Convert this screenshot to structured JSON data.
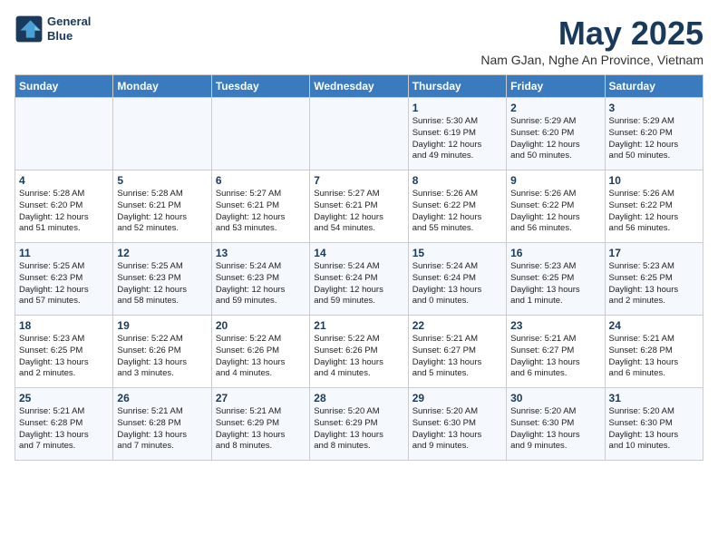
{
  "header": {
    "logo_line1": "General",
    "logo_line2": "Blue",
    "month": "May 2025",
    "location": "Nam GJan, Nghe An Province, Vietnam"
  },
  "weekdays": [
    "Sunday",
    "Monday",
    "Tuesday",
    "Wednesday",
    "Thursday",
    "Friday",
    "Saturday"
  ],
  "weeks": [
    [
      {
        "day": "",
        "info": ""
      },
      {
        "day": "",
        "info": ""
      },
      {
        "day": "",
        "info": ""
      },
      {
        "day": "",
        "info": ""
      },
      {
        "day": "1",
        "info": "Sunrise: 5:30 AM\nSunset: 6:19 PM\nDaylight: 12 hours\nand 49 minutes."
      },
      {
        "day": "2",
        "info": "Sunrise: 5:29 AM\nSunset: 6:20 PM\nDaylight: 12 hours\nand 50 minutes."
      },
      {
        "day": "3",
        "info": "Sunrise: 5:29 AM\nSunset: 6:20 PM\nDaylight: 12 hours\nand 50 minutes."
      }
    ],
    [
      {
        "day": "4",
        "info": "Sunrise: 5:28 AM\nSunset: 6:20 PM\nDaylight: 12 hours\nand 51 minutes."
      },
      {
        "day": "5",
        "info": "Sunrise: 5:28 AM\nSunset: 6:21 PM\nDaylight: 12 hours\nand 52 minutes."
      },
      {
        "day": "6",
        "info": "Sunrise: 5:27 AM\nSunset: 6:21 PM\nDaylight: 12 hours\nand 53 minutes."
      },
      {
        "day": "7",
        "info": "Sunrise: 5:27 AM\nSunset: 6:21 PM\nDaylight: 12 hours\nand 54 minutes."
      },
      {
        "day": "8",
        "info": "Sunrise: 5:26 AM\nSunset: 6:22 PM\nDaylight: 12 hours\nand 55 minutes."
      },
      {
        "day": "9",
        "info": "Sunrise: 5:26 AM\nSunset: 6:22 PM\nDaylight: 12 hours\nand 56 minutes."
      },
      {
        "day": "10",
        "info": "Sunrise: 5:26 AM\nSunset: 6:22 PM\nDaylight: 12 hours\nand 56 minutes."
      }
    ],
    [
      {
        "day": "11",
        "info": "Sunrise: 5:25 AM\nSunset: 6:23 PM\nDaylight: 12 hours\nand 57 minutes."
      },
      {
        "day": "12",
        "info": "Sunrise: 5:25 AM\nSunset: 6:23 PM\nDaylight: 12 hours\nand 58 minutes."
      },
      {
        "day": "13",
        "info": "Sunrise: 5:24 AM\nSunset: 6:23 PM\nDaylight: 12 hours\nand 59 minutes."
      },
      {
        "day": "14",
        "info": "Sunrise: 5:24 AM\nSunset: 6:24 PM\nDaylight: 12 hours\nand 59 minutes."
      },
      {
        "day": "15",
        "info": "Sunrise: 5:24 AM\nSunset: 6:24 PM\nDaylight: 13 hours\nand 0 minutes."
      },
      {
        "day": "16",
        "info": "Sunrise: 5:23 AM\nSunset: 6:25 PM\nDaylight: 13 hours\nand 1 minute."
      },
      {
        "day": "17",
        "info": "Sunrise: 5:23 AM\nSunset: 6:25 PM\nDaylight: 13 hours\nand 2 minutes."
      }
    ],
    [
      {
        "day": "18",
        "info": "Sunrise: 5:23 AM\nSunset: 6:25 PM\nDaylight: 13 hours\nand 2 minutes."
      },
      {
        "day": "19",
        "info": "Sunrise: 5:22 AM\nSunset: 6:26 PM\nDaylight: 13 hours\nand 3 minutes."
      },
      {
        "day": "20",
        "info": "Sunrise: 5:22 AM\nSunset: 6:26 PM\nDaylight: 13 hours\nand 4 minutes."
      },
      {
        "day": "21",
        "info": "Sunrise: 5:22 AM\nSunset: 6:26 PM\nDaylight: 13 hours\nand 4 minutes."
      },
      {
        "day": "22",
        "info": "Sunrise: 5:21 AM\nSunset: 6:27 PM\nDaylight: 13 hours\nand 5 minutes."
      },
      {
        "day": "23",
        "info": "Sunrise: 5:21 AM\nSunset: 6:27 PM\nDaylight: 13 hours\nand 6 minutes."
      },
      {
        "day": "24",
        "info": "Sunrise: 5:21 AM\nSunset: 6:28 PM\nDaylight: 13 hours\nand 6 minutes."
      }
    ],
    [
      {
        "day": "25",
        "info": "Sunrise: 5:21 AM\nSunset: 6:28 PM\nDaylight: 13 hours\nand 7 minutes."
      },
      {
        "day": "26",
        "info": "Sunrise: 5:21 AM\nSunset: 6:28 PM\nDaylight: 13 hours\nand 7 minutes."
      },
      {
        "day": "27",
        "info": "Sunrise: 5:21 AM\nSunset: 6:29 PM\nDaylight: 13 hours\nand 8 minutes."
      },
      {
        "day": "28",
        "info": "Sunrise: 5:20 AM\nSunset: 6:29 PM\nDaylight: 13 hours\nand 8 minutes."
      },
      {
        "day": "29",
        "info": "Sunrise: 5:20 AM\nSunset: 6:30 PM\nDaylight: 13 hours\nand 9 minutes."
      },
      {
        "day": "30",
        "info": "Sunrise: 5:20 AM\nSunset: 6:30 PM\nDaylight: 13 hours\nand 9 minutes."
      },
      {
        "day": "31",
        "info": "Sunrise: 5:20 AM\nSunset: 6:30 PM\nDaylight: 13 hours\nand 10 minutes."
      }
    ]
  ]
}
